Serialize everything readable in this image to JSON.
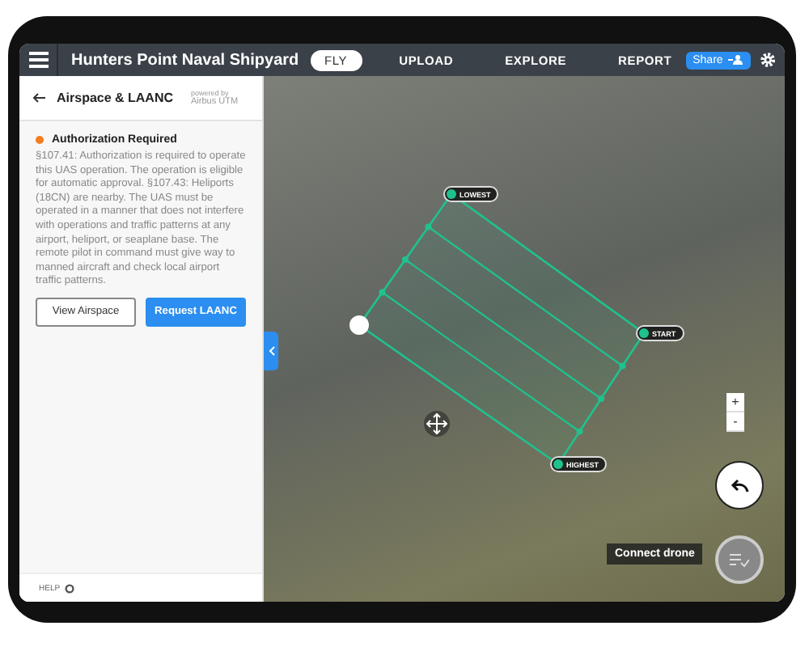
{
  "header": {
    "title": "Hunters Point Naval Shipyard",
    "tabs": [
      {
        "label": "FLY",
        "selected": true
      },
      {
        "label": "UPLOAD",
        "selected": false
      },
      {
        "label": "EXPLORE",
        "selected": false
      },
      {
        "label": "REPORT",
        "selected": false
      }
    ],
    "share": "Share"
  },
  "panel": {
    "title": "Airspace & LAANC",
    "powered_by": "powered by",
    "provider": "Airbus UTM",
    "alert": {
      "title": "Authorization Required",
      "body": "§107.41: Authorization is required to operate this UAS operation. The operation is eligible for automatic approval. §107.43: Heliports (18CN) are nearby. The UAS must be operated in a manner that does not interfere with operations and traffic patterns at any airport, heliport, or seaplane base. The remote pilot in command must give way to manned aircraft and check local airport traffic patterns."
    },
    "buttons": [
      {
        "label": "View Airspace",
        "primary": false
      },
      {
        "label": "Request LAANC",
        "primary": true
      }
    ],
    "help": "HELP"
  },
  "map": {
    "markers": [
      {
        "label": "LOWEST"
      },
      {
        "label": "START"
      },
      {
        "label": "HIGHEST"
      }
    ],
    "zoom_in": "+",
    "zoom_out": "-",
    "connect": "Connect drone"
  }
}
